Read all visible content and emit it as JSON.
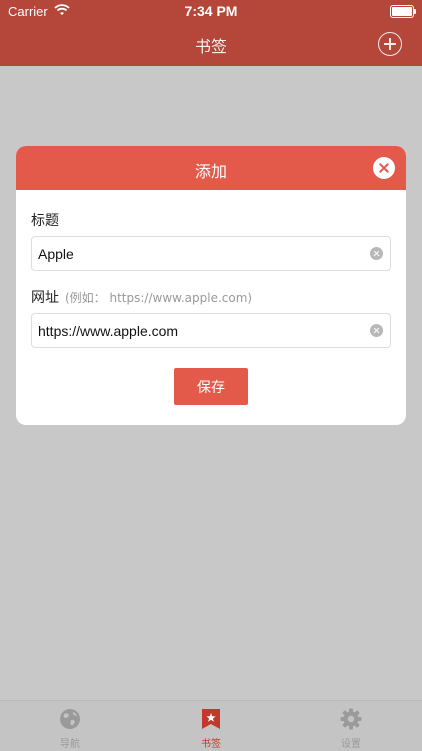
{
  "status_bar": {
    "carrier": "Carrier",
    "time": "7:34 PM",
    "battery_level": 1.0
  },
  "navbar": {
    "title": "书签"
  },
  "dialog": {
    "title": "添加",
    "title_label": "标题",
    "title_value": "Apple",
    "url_label": "网址",
    "url_hint": "(例如：  https://www.apple.com)",
    "url_value": "https://www.apple.com",
    "save_label": "保存"
  },
  "tabbar": {
    "items": [
      {
        "label": "导航",
        "icon": "globe-icon",
        "active": false
      },
      {
        "label": "书签",
        "icon": "bookmark-icon",
        "active": true
      },
      {
        "label": "设置",
        "icon": "gear-icon",
        "active": false
      }
    ]
  },
  "colors": {
    "navbar": "#b5463a",
    "accent": "#e35a4b",
    "backdrop": "#c8c8c8"
  }
}
